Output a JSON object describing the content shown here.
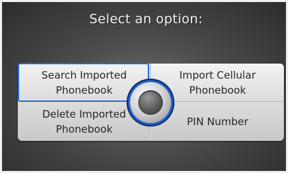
{
  "title": "Select an option:",
  "options": {
    "search_imported": {
      "line1": "Search Imported",
      "line2": "Phonebook",
      "selected": true
    },
    "import_cellular": {
      "line1": "Import Cellular",
      "line2": "Phonebook",
      "selected": false
    },
    "delete_imported": {
      "line1": "Delete Imported",
      "line2": "Phonebook",
      "selected": false
    },
    "pin_number": {
      "line1": "PIN Number",
      "selected": false
    }
  },
  "colors": {
    "selection": "#1f6fd8",
    "background": "#4a4a4a",
    "panel": "#dedede",
    "title_text": "#f4f4f4"
  },
  "icons": {
    "center_knob": "interface-dial-knob"
  }
}
